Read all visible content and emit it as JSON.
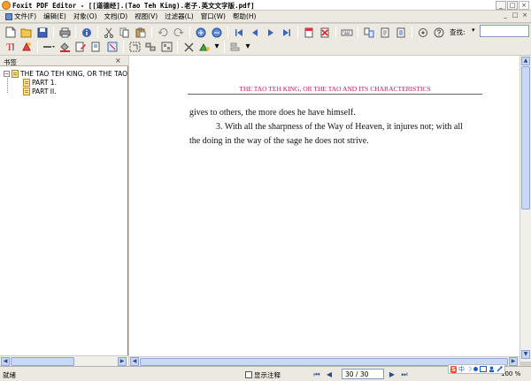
{
  "window": {
    "title": "Foxit PDF Editor - [[道德经].(Tao Teh King).老子.英文文字版.pdf]",
    "minimize": "_",
    "maximize": "□",
    "close": "×"
  },
  "menu": [
    {
      "label": "文件(F)"
    },
    {
      "label": "编辑(E)"
    },
    {
      "label": "对象(O)"
    },
    {
      "label": "文档(D)"
    },
    {
      "label": "视图(V)"
    },
    {
      "label": "过滤器(L)"
    },
    {
      "label": "窗口(W)"
    },
    {
      "label": "帮助(H)"
    }
  ],
  "toolbar": {
    "find_label": "查找:",
    "find_value": "",
    "dropdown_arrow": "▾"
  },
  "bookmarks": {
    "title": "书签",
    "close": "×",
    "root": "THE TAO TEH KING, OR THE TAO A",
    "expander": "−",
    "children": [
      "PART 1.",
      "PART II."
    ]
  },
  "document": {
    "page_header": "THE TAO TEH KING, OR THE TAO AND ITS CHARACTERISTICS",
    "lines": [
      "gives to others, the more does he have himself.",
      "3. With all the sharpness of the Way of Heaven, it injures not; with all",
      "the doing in the way of the sage he does not strive."
    ]
  },
  "statusbar": {
    "ready": "就绪",
    "annotations_label": "显示注释",
    "page_indicator": "30 / 30",
    "zoom": "100 %"
  },
  "ime": {
    "brand": "S",
    "lang": "中",
    "moon": "☽"
  },
  "colors": {
    "header_red": "#c2185b",
    "scroll_blue": "#c9d8f7"
  }
}
